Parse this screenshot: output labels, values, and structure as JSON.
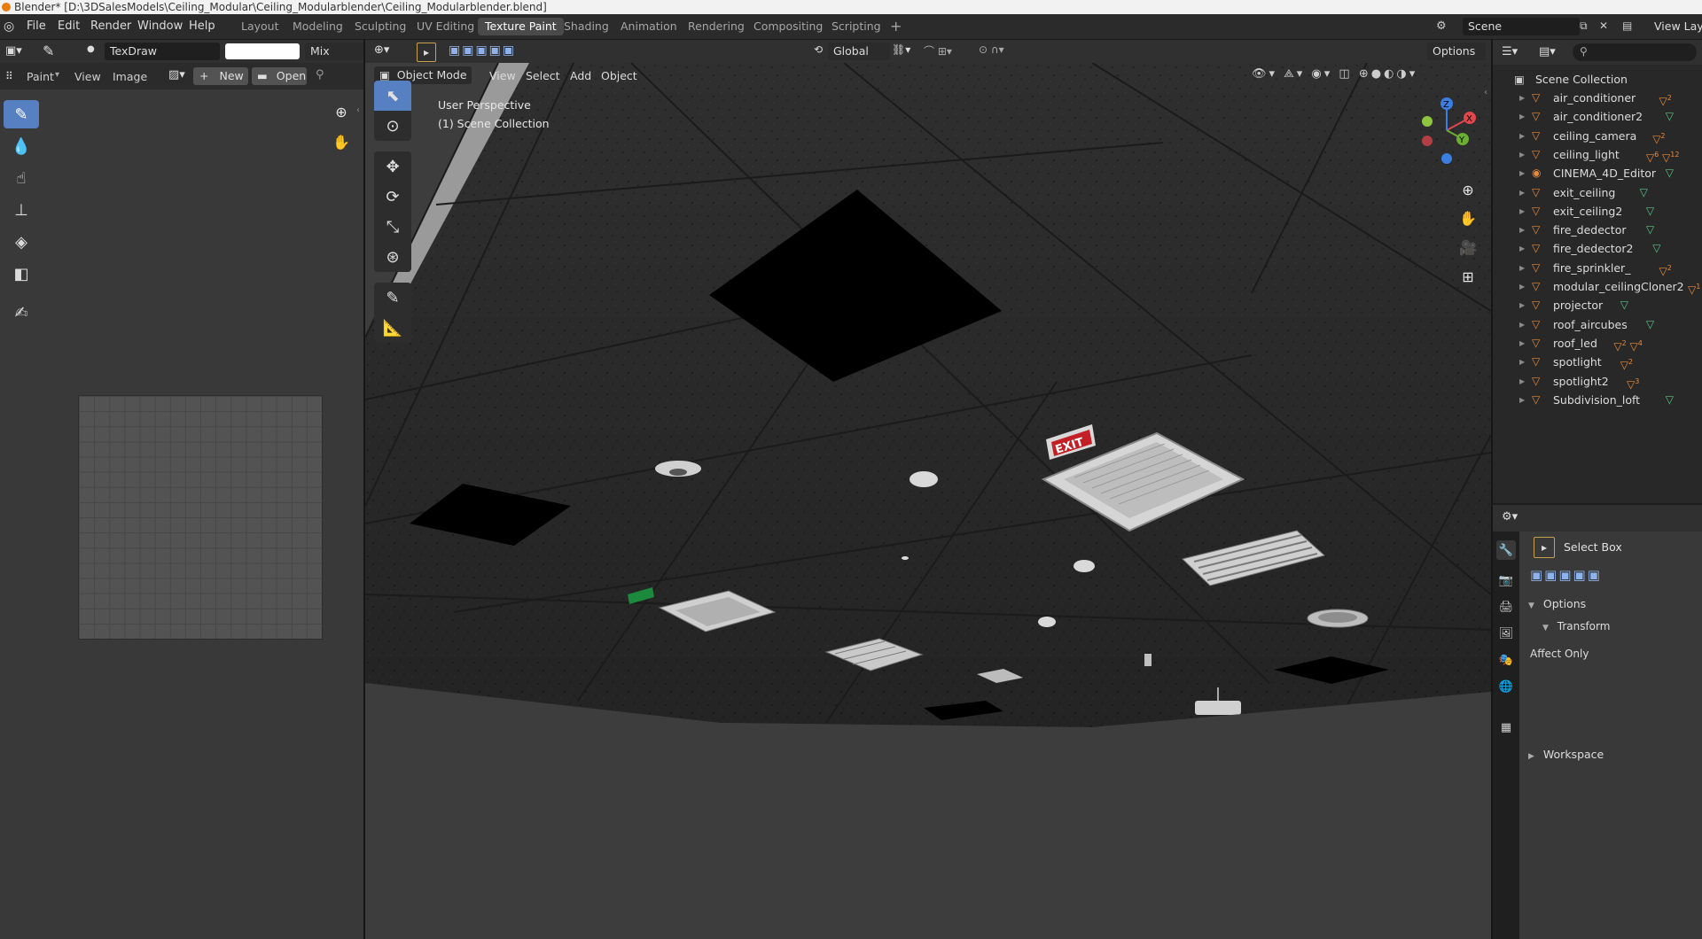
{
  "titlebar": {
    "text": "Blender* [D:\\3DSalesModels\\Ceiling_Modular\\Ceiling_Modularblender\\Ceiling_Modularblender.blend]"
  },
  "menu": [
    "File",
    "Edit",
    "Render",
    "Window",
    "Help"
  ],
  "workspaces": [
    {
      "label": "Layout"
    },
    {
      "label": "Modeling"
    },
    {
      "label": "Sculpting"
    },
    {
      "label": "UV Editing"
    },
    {
      "label": "Texture Paint"
    },
    {
      "label": "Shading"
    },
    {
      "label": "Animation"
    },
    {
      "label": "Rendering"
    },
    {
      "label": "Compositing"
    },
    {
      "label": "Scripting"
    }
  ],
  "active_workspace": "Texture Paint",
  "scene": {
    "name": "Scene",
    "view_layer": "View Layer"
  },
  "image_editor": {
    "brush": "TexDraw",
    "blend": "Mix",
    "brush_color": "#ffffff",
    "menus": [
      "Paint",
      "View",
      "Image"
    ],
    "new_label": "New",
    "open_label": "Open"
  },
  "viewport": {
    "mode": "Object Mode",
    "menus": [
      "View",
      "Select",
      "Add",
      "Object"
    ],
    "orientation": "Global",
    "options_label": "Options",
    "overlay_line1": "User Perspective",
    "overlay_line2": "(1) Scene Collection",
    "exit_sign_text": "EXIT",
    "gizmo_axes": [
      "X",
      "Y",
      "Z"
    ]
  },
  "outliner": {
    "root": "Scene Collection",
    "items": [
      {
        "name": "air_conditioner",
        "sub": "2"
      },
      {
        "name": "air_conditioner2",
        "sub": ""
      },
      {
        "name": "ceiling_camera",
        "sub": "2"
      },
      {
        "name": "ceiling_light",
        "sub": "6",
        "sub2": "12"
      },
      {
        "name": "CINEMA_4D_Editor",
        "sub": ""
      },
      {
        "name": "exit_ceiling",
        "sub": ""
      },
      {
        "name": "exit_ceiling2",
        "sub": ""
      },
      {
        "name": "fire_dedector",
        "sub": ""
      },
      {
        "name": "fire_dedector2",
        "sub": ""
      },
      {
        "name": "fire_sprinkler_",
        "sub": "2"
      },
      {
        "name": "modular_ceilingCloner2",
        "sub": "1"
      },
      {
        "name": "projector",
        "sub": ""
      },
      {
        "name": "roof_aircubes",
        "sub": ""
      },
      {
        "name": "roof_led",
        "sub": "2",
        "sub2": "4"
      },
      {
        "name": "spotlight",
        "sub": "2"
      },
      {
        "name": "spotlight2",
        "sub": "3"
      },
      {
        "name": "Subdivision_loft",
        "sub": ""
      }
    ]
  },
  "properties": {
    "tool_name": "Select Box",
    "options_label": "Options",
    "transform_label": "Transform",
    "affect_only_label": "Affect Only",
    "workspace_label": "Workspace"
  },
  "colors": {
    "accent": "#5680c2",
    "orange": "#e9893a",
    "mesh_green": "#5bc48d"
  }
}
